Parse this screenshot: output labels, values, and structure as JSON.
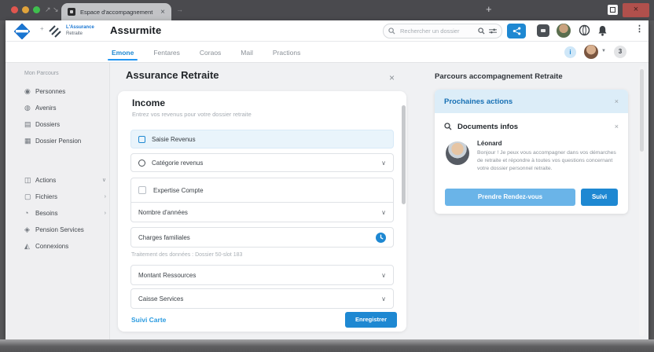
{
  "glyphs": {
    "close": "×",
    "chevron_down": "∨",
    "chevron_right": "›",
    "caret_down": "▼",
    "plus": "+",
    "arrow_ne": "↗",
    "arrow_se": "↘",
    "arrow_right": "→",
    "kebab": "⋮",
    "info": "i"
  },
  "browser": {
    "tab_title": "Espace d'accompagnement"
  },
  "appbar": {
    "brand_line1": "L'Assurance",
    "brand_line2": "Retraite",
    "title": "Assurmite",
    "search_placeholder": "Rechercher un dossier"
  },
  "subnav": {
    "tabs": [
      {
        "label": "Emone"
      },
      {
        "label": "Fentares"
      },
      {
        "label": "Coraos"
      },
      {
        "label": "Mail"
      },
      {
        "label": "Practions"
      }
    ],
    "notification_count": "3"
  },
  "sidebar": {
    "section1": {
      "header": "Mon Parcours",
      "items": [
        {
          "icon_glyph": "◉",
          "label": "Personnes"
        },
        {
          "icon_glyph": "◍",
          "label": "Avenirs"
        },
        {
          "icon_glyph": "▤",
          "label": "Dossiers"
        },
        {
          "icon_glyph": "▦",
          "label": "Dossier Pension"
        }
      ]
    },
    "section2": {
      "items": [
        {
          "icon_glyph": "◫",
          "label": "Actions"
        },
        {
          "icon_glyph": "▢",
          "label": "Fichiers"
        },
        {
          "icon_glyph": "◔",
          "label": "Besoins"
        },
        {
          "icon_glyph": "◈",
          "label": "Pension Services"
        },
        {
          "icon_glyph": "◭",
          "label": "Connexions"
        }
      ]
    }
  },
  "main": {
    "page_title": "Assurance Retraite",
    "card": {
      "title": "Income",
      "subtitle": "Entrez vos revenus pour votre dossier retraite",
      "highlight_row": "Saisie Revenus",
      "category_row": "Catégorie revenus",
      "checkbox_label": "Expertise Compte",
      "years_dropdown": "Nombre d'années",
      "charges_row": "Charges familiales",
      "helper": "Traitement des données : Dossier 50-slot 183",
      "footer_link": "Suivi Carte",
      "submit_button": "Enregistrer"
    }
  },
  "aside": {
    "header": "Parcours accompagnement Retraite",
    "panel_title": "Prochaines actions",
    "section_title": "Documents infos",
    "advisor": {
      "name": "Léonard",
      "bio": "Bonjour ! Je peux vous accompagner dans vos démarches de retraite et répondre à toutes vos questions concernant votre dossier personnel retraite."
    },
    "primary_button": "Prendre Rendez-vous",
    "secondary_button": "Suivi"
  },
  "colors": {
    "accent": "#1e88d2",
    "accent_light": "#6ab4e8",
    "highlight_bg": "#e9f4fb",
    "panel_header_bg": "#dcedf8",
    "active_tab": "#2196f3",
    "close_button_red": "#b0504c"
  }
}
